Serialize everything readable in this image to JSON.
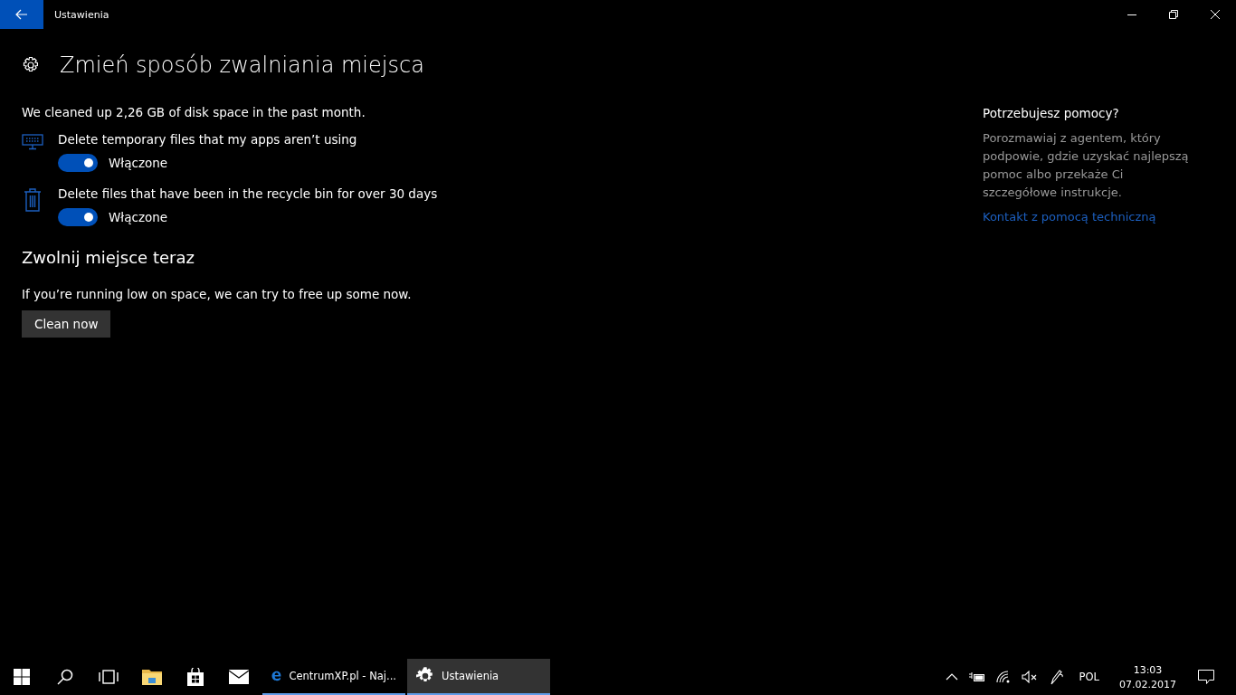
{
  "window": {
    "title": "Ustawienia"
  },
  "page": {
    "title": "Zmień sposób zwalniania miejsca",
    "summary": "We cleaned up 2,26 GB of disk space in the past month.",
    "options": [
      {
        "kind": "temp",
        "label": "Delete temporary files that my apps aren’t using",
        "on": true,
        "state_label": "Włączone"
      },
      {
        "kind": "bin",
        "label": "Delete files that have been in the recycle bin for over 30 days",
        "on": true,
        "state_label": "Włączone"
      }
    ],
    "free_now": {
      "heading": "Zwolnij miejsce teraz",
      "text": "If you’re running low on space, we can try to free up some now.",
      "button": "Clean now"
    }
  },
  "help": {
    "heading": "Potrzebujesz pomocy?",
    "text": "Porozmawiaj z agentem, który podpowie, gdzie uzyskać najlepszą pomoc albo przekaże Ci szczegółowe instrukcje.",
    "link": "Kontakt z pomocą techniczną"
  },
  "taskbar": {
    "pinned": [
      {
        "kind": "start"
      },
      {
        "kind": "search"
      },
      {
        "kind": "taskview"
      },
      {
        "kind": "folder"
      },
      {
        "kind": "store"
      },
      {
        "kind": "mail"
      }
    ],
    "windows": [
      {
        "kind": "edge",
        "label": "CentrumXP.pl - Naj...",
        "selected": false
      },
      {
        "kind": "gear",
        "label": "Ustawienia",
        "selected": true
      }
    ],
    "language": "POL",
    "time": "13:03",
    "date": "07.02.2017"
  }
}
